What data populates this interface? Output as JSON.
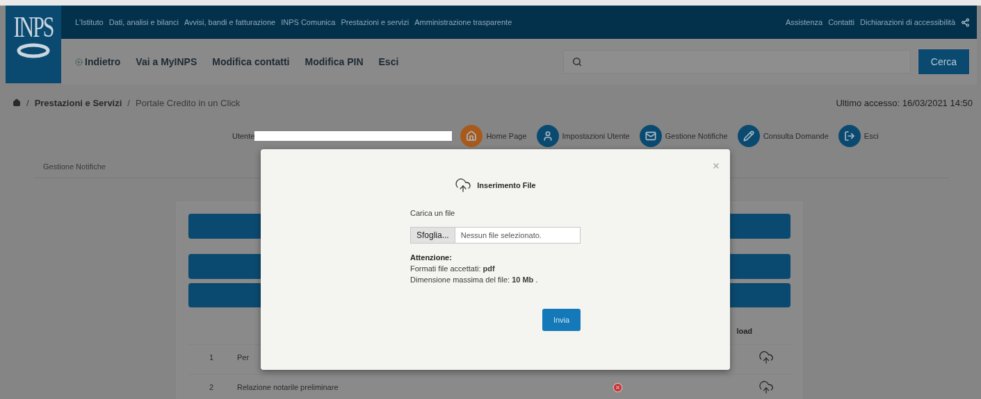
{
  "logo": "INPS",
  "top_nav": {
    "links": [
      "L'Istituto",
      "Dati, analisi e bilanci",
      "Avvisi, bandi e fatturazione",
      "INPS Comunica",
      "Prestazioni e servizi",
      "Amministrazione trasparente"
    ],
    "right_links": [
      "Assistenza",
      "Contatti",
      "Dichiarazioni di accessibilità"
    ]
  },
  "main_nav": [
    {
      "label": "Indietro",
      "kind": "back"
    },
    {
      "label": "Vai a MyINPS",
      "kind": "link"
    },
    {
      "label": "Modifica contatti",
      "kind": "link"
    },
    {
      "label": "Modifica PIN",
      "kind": "link"
    },
    {
      "label": "Esci",
      "kind": "link"
    }
  ],
  "search": {
    "button": "Cerca"
  },
  "breadcrumb": {
    "separator": "/",
    "items": [
      "Prestazioni e Servizi",
      "Portale Credito in un Click"
    ]
  },
  "last_access": "Ultimo accesso: 16/03/2021 14:50",
  "user": {
    "label": "Utente"
  },
  "user_actions": [
    {
      "label": "Home Page",
      "kind": "home",
      "color": "#a85a1c"
    },
    {
      "label": "Impostazioni Utente",
      "kind": "user",
      "color": "#0b4a70"
    },
    {
      "label": "Gestione Notifiche",
      "kind": "mail",
      "color": "#0b4a70"
    },
    {
      "label": "Consulta Domande",
      "kind": "edit",
      "color": "#0b4a70"
    },
    {
      "label": "Esci",
      "kind": "exit",
      "color": "#0b4a70"
    }
  ],
  "tab": "Gestione Notifiche",
  "table": {
    "header_partial": "load",
    "rows": [
      {
        "number": "1",
        "title": "Per"
      },
      {
        "number": "2",
        "title": "Relazione notarile preliminare",
        "error": true
      }
    ]
  },
  "modal": {
    "title": "Inserimento File",
    "field_label": "Carica un file",
    "browse_button": "Sfoglia...",
    "file_status": "Nessun file selezionato.",
    "notice_title": "Attenzione:",
    "notes": [
      "Formati file accettati: **pdf**",
      "Dimensione massima del file: **10 Mb** ."
    ],
    "submit": "Invia"
  }
}
